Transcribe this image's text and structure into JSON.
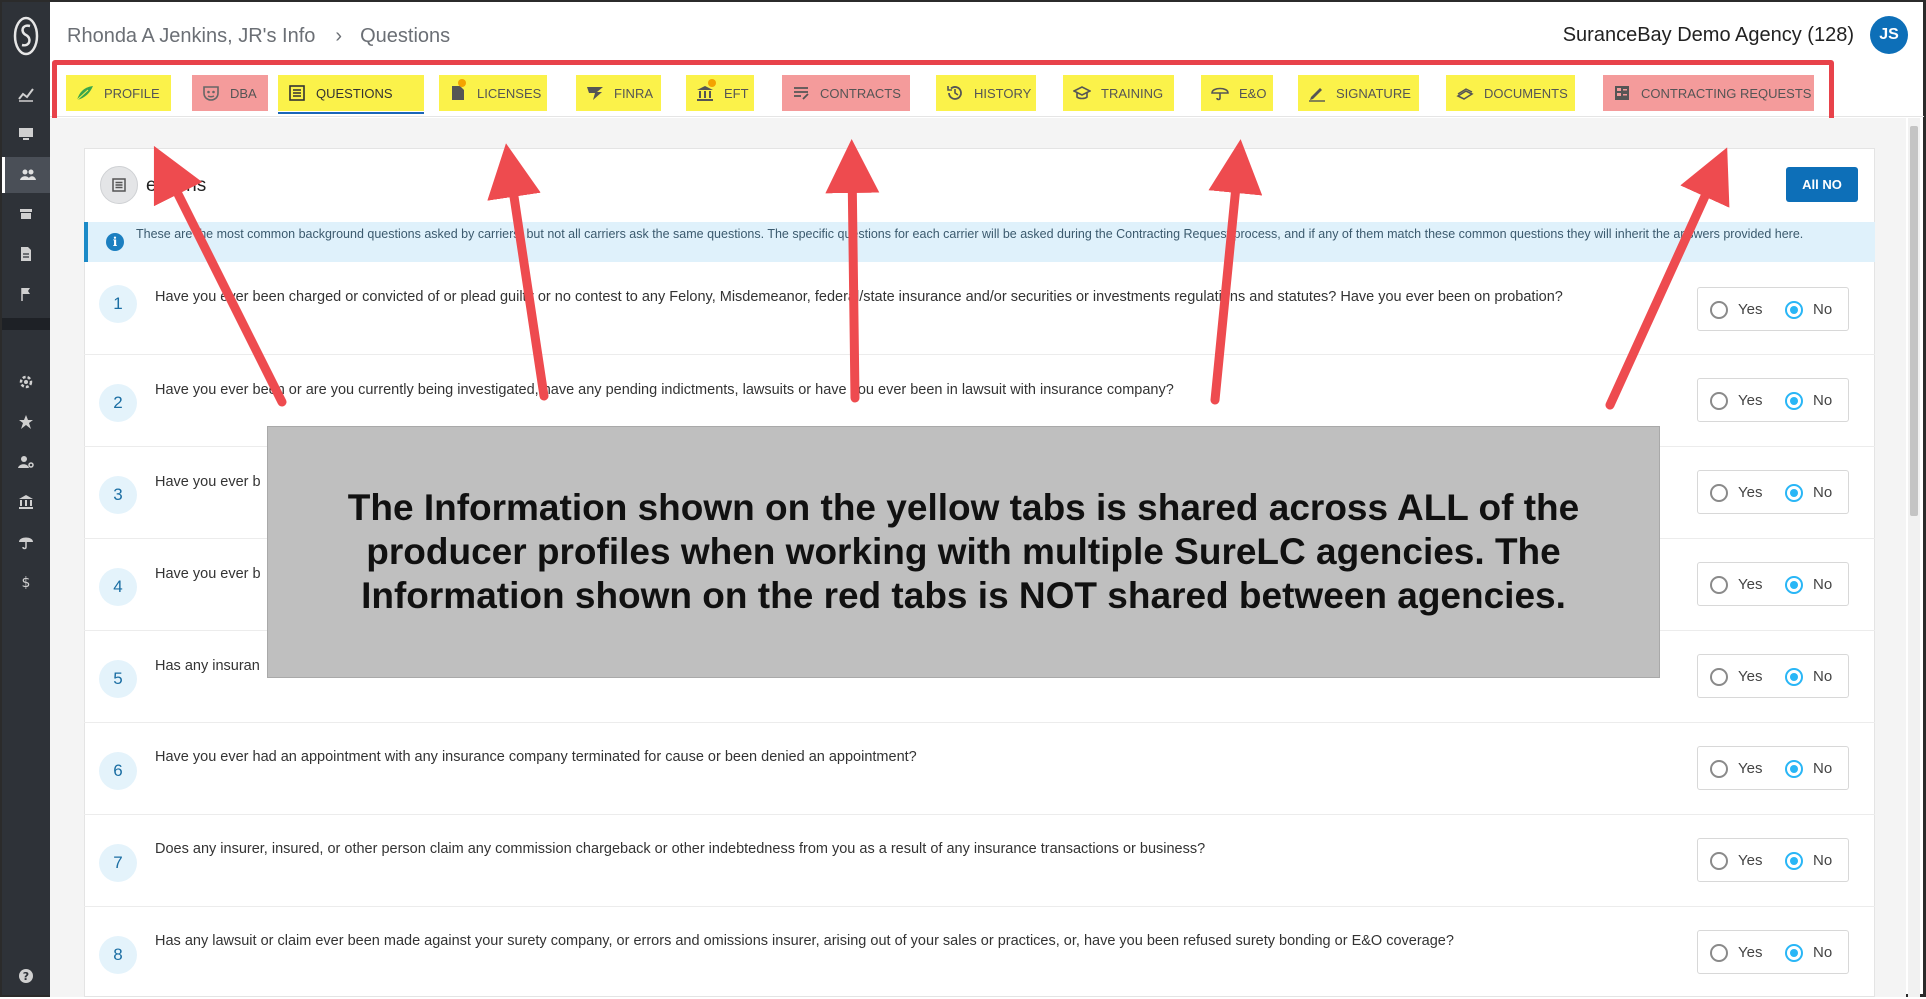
{
  "header": {
    "breadcrumb_person": "Rhonda A Jenkins, JR's Info",
    "breadcrumb_page": "Questions",
    "agency": "SuranceBay Demo Agency (128)",
    "avatar_initials": "JS"
  },
  "sidebar": {
    "items": [
      {
        "icon": "chart-line-icon"
      },
      {
        "icon": "monitor-icon"
      },
      {
        "icon": "people-icon",
        "active": true
      },
      {
        "icon": "store-icon"
      },
      {
        "icon": "document-icon"
      },
      {
        "icon": "flag-icon"
      },
      {
        "icon": "gear-icon"
      },
      {
        "icon": "star-badge-icon"
      },
      {
        "icon": "user-settings-icon"
      },
      {
        "icon": "bank-icon"
      },
      {
        "icon": "umbrella-icon"
      },
      {
        "icon": "dollar-icon"
      },
      {
        "icon": "help-icon"
      }
    ]
  },
  "tabs": [
    {
      "label": "PROFILE",
      "color": "yellow",
      "icon": "leaf-icon"
    },
    {
      "label": "DBA",
      "color": "red",
      "icon": "mask-icon"
    },
    {
      "label": "QUESTIONS",
      "color": "yellow",
      "icon": "list-icon",
      "active": true
    },
    {
      "label": "LICENSES",
      "color": "yellow",
      "icon": "license-icon",
      "badge": true
    },
    {
      "label": "FINRA",
      "color": "yellow",
      "icon": "finra-icon"
    },
    {
      "label": "EFT",
      "color": "yellow",
      "icon": "bank-icon",
      "badge": true
    },
    {
      "label": "CONTRACTS",
      "color": "red",
      "icon": "contract-icon"
    },
    {
      "label": "HISTORY",
      "color": "yellow",
      "icon": "history-icon"
    },
    {
      "label": "TRAINING",
      "color": "yellow",
      "icon": "graduation-cap-icon"
    },
    {
      "label": "E&O",
      "color": "yellow",
      "icon": "umbrella-icon"
    },
    {
      "label": "SIGNATURE",
      "color": "yellow",
      "icon": "pen-icon"
    },
    {
      "label": "DOCUMENTS",
      "color": "yellow",
      "icon": "documents-icon"
    },
    {
      "label": "CONTRACTING REQUESTS",
      "color": "red",
      "icon": "requests-icon"
    }
  ],
  "card": {
    "title": "Questions",
    "title_visible": "estions",
    "all_no_label": "All NO",
    "info_text": "These are the most common background questions asked by carriers, but not all carriers ask the same questions. The specific questions for each carrier will be asked during the Contracting Request process, and if any of them match these common questions they will inherit the answers provided here."
  },
  "options": {
    "yes": "Yes",
    "no": "No"
  },
  "questions": [
    {
      "num": "1",
      "text": "Have you ever been charged or convicted of or plead guilty or no contest to any Felony, Misdemeanor, federal/state insurance and/or securities or investments regulations and statutes? Have you ever been on probation?",
      "answer": "No"
    },
    {
      "num": "2",
      "text": "Have you ever been or are you currently being investigated, have any pending indictments, lawsuits or have you ever been in lawsuit with insurance company?",
      "answer": "No"
    },
    {
      "num": "3",
      "text": "Have you ever b",
      "answer": "No"
    },
    {
      "num": "4",
      "text": "Have you ever b",
      "answer": "No"
    },
    {
      "num": "5",
      "text": "Has any insuran",
      "answer": "No"
    },
    {
      "num": "6",
      "text": "Have you ever had an appointment with any insurance company terminated for cause or been denied an appointment?",
      "answer": "No"
    },
    {
      "num": "7",
      "text": "Does any insurer, insured, or other person claim any commission chargeback or other indebtedness from you as a result of any insurance transactions or business?",
      "answer": "No"
    },
    {
      "num": "8",
      "text": "Has any lawsuit or claim ever been made against your surety company, or errors and omissions insurer, arising out of your sales or practices, or, have you been refused surety bonding or E&O coverage?",
      "answer": "No"
    }
  ],
  "overlay": {
    "text": "The Information shown on the yellow tabs is shared across ALL of the producer profiles when working with multiple SureLC agencies.  The Information shown on the red tabs is NOT shared between agencies."
  },
  "colors": {
    "yellow_tab": "#fbf24a",
    "red_tab": "#f49b9b",
    "annotation_red": "#e8424a",
    "brand_blue": "#0d6fb8",
    "radio_checked": "#29b6f6"
  }
}
